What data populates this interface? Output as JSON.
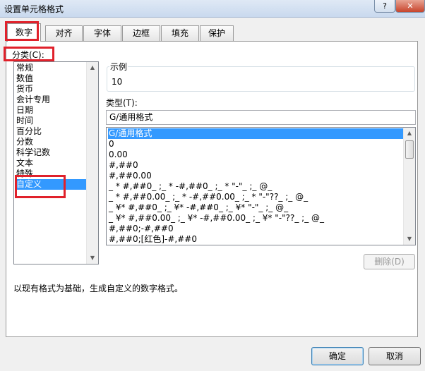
{
  "window": {
    "title": "设置单元格格式",
    "help": "?",
    "close": "✕"
  },
  "tabs": [
    "数字",
    "对齐",
    "字体",
    "边框",
    "填充",
    "保护"
  ],
  "category": {
    "label": "分类(C):",
    "items": [
      "常规",
      "数值",
      "货币",
      "会计专用",
      "日期",
      "时间",
      "百分比",
      "分数",
      "科学记数",
      "文本",
      "特殊",
      "自定义"
    ],
    "selected": "自定义"
  },
  "sample": {
    "legend": "示例",
    "value": "10"
  },
  "type": {
    "label": "类型(T):",
    "value": "G/通用格式",
    "formats": [
      "G/通用格式",
      "0",
      "0.00",
      "#,##0",
      "#,##0.00",
      "_ * #,##0_ ;_ * -#,##0_ ;_ * \"-\"_ ;_ @_",
      "_ * #,##0.00_ ;_ * -#,##0.00_ ;_ * \"-\"??_ ;_ @_",
      "_ ¥* #,##0_ ;_ ¥* -#,##0_ ;_ ¥* \"-\"_ ;_ @_",
      "_ ¥* #,##0.00_ ;_ ¥* -#,##0.00_ ;_ ¥* \"-\"??_ ;_ @_",
      "#,##0;-#,##0",
      "#,##0;[红色]-#,##0"
    ],
    "selected": "G/通用格式"
  },
  "buttons": {
    "delete": "删除(D)",
    "ok": "确定",
    "cancel": "取消"
  },
  "description": "以现有格式为基础，生成自定义的数字格式。",
  "colors": {
    "selection": "#3399ff",
    "annotation": "#e0212b"
  }
}
